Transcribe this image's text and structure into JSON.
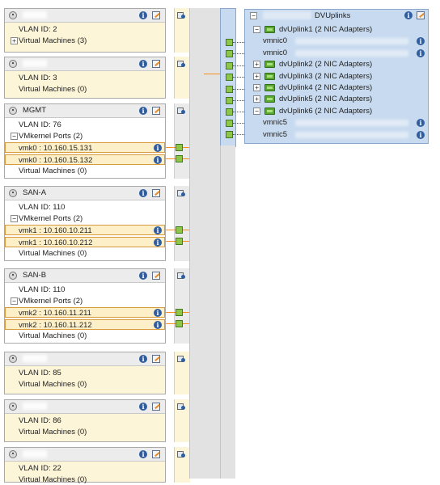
{
  "port_groups": [
    {
      "title": "",
      "rows": [
        {
          "text": "VLAN ID: 2",
          "kind": "plain"
        },
        {
          "text": "Virtual Machines (3)",
          "kind": "expand",
          "expander": "+"
        }
      ]
    },
    {
      "title": "",
      "rows": [
        {
          "text": "VLAN ID: 3",
          "kind": "plain"
        },
        {
          "text": "Virtual Machines (0)",
          "kind": "plain"
        }
      ]
    },
    {
      "title": "MGMT",
      "rows": [
        {
          "text": "VLAN ID: 76",
          "kind": "plain"
        },
        {
          "text": "VMkernel Ports (2)",
          "kind": "expand",
          "expander": "−"
        },
        {
          "text": "vmk0 : 10.160.15.131",
          "kind": "port"
        },
        {
          "text": "vmk0 : 10.160.15.132",
          "kind": "port"
        },
        {
          "text": "Virtual Machines (0)",
          "kind": "plain"
        }
      ]
    },
    {
      "title": "SAN-A",
      "rows": [
        {
          "text": "VLAN ID: 110",
          "kind": "plain"
        },
        {
          "text": "VMkernel Ports (2)",
          "kind": "expand",
          "expander": "−"
        },
        {
          "text": "vmk1 : 10.160.10.211",
          "kind": "port"
        },
        {
          "text": "vmk1 : 10.160.10.212",
          "kind": "port"
        },
        {
          "text": "Virtual Machines (0)",
          "kind": "plain"
        }
      ]
    },
    {
      "title": "SAN-B",
      "rows": [
        {
          "text": "VLAN ID: 110",
          "kind": "plain"
        },
        {
          "text": "VMkernel Ports (2)",
          "kind": "expand",
          "expander": "−"
        },
        {
          "text": "vmk2 : 10.160.11.211",
          "kind": "port"
        },
        {
          "text": "vmk2 : 10.160.11.212",
          "kind": "port"
        },
        {
          "text": "Virtual Machines (0)",
          "kind": "plain"
        }
      ]
    },
    {
      "title": "",
      "rows": [
        {
          "text": "VLAN ID: 85",
          "kind": "plain"
        },
        {
          "text": "Virtual Machines (0)",
          "kind": "plain"
        }
      ]
    },
    {
      "title": "",
      "rows": [
        {
          "text": "VLAN ID: 86",
          "kind": "plain"
        },
        {
          "text": "Virtual Machines (0)",
          "kind": "plain"
        }
      ]
    },
    {
      "title": "",
      "rows": [
        {
          "text": "VLAN ID: 22",
          "kind": "plain"
        },
        {
          "text": "Virtual Machines (0)",
          "kind": "plain"
        }
      ]
    }
  ],
  "uplinks": {
    "title": "DVUplinks",
    "items": [
      {
        "label": "dvUplink1 (2 NIC Adapters)",
        "expander": "−",
        "nics": [
          "vmnic0",
          "vmnic0"
        ]
      },
      {
        "label": "dvUplink2 (2 NIC Adapters)",
        "expander": "+",
        "nics": []
      },
      {
        "label": "dvUplink3 (2 NIC Adapters)",
        "expander": "+",
        "nics": []
      },
      {
        "label": "dvUplink4 (2 NIC Adapters)",
        "expander": "+",
        "nics": []
      },
      {
        "label": "dvUplink5 (2 NIC Adapters)",
        "expander": "+",
        "nics": []
      },
      {
        "label": "dvUplink6 (2 NIC Adapters)",
        "expander": "−",
        "nics": [
          "vmnic5",
          "vmnic5"
        ]
      }
    ]
  },
  "icons": {
    "info": "info-icon",
    "edit": "edit-icon",
    "port_group": "port-group-icon",
    "nic": "nic-icon",
    "connection": "connection-icon",
    "info_glyph": "i"
  },
  "colors": {
    "selected_bg": "#fdf5d8",
    "link_orange": "#f5901e",
    "uplink_panel": "#c7daef",
    "port_green": "#8ec64a"
  }
}
